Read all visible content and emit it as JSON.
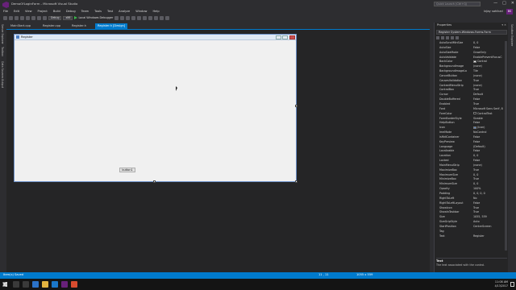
{
  "window": {
    "title": "DemoOfLoginForm - Microsoft Visual Studio",
    "quick_launch_placeholder": "Quick Launch (Ctrl+Q)",
    "user_name": "bijay sahikari",
    "user_initials": "BS",
    "controls": [
      "—",
      "□",
      "✕"
    ]
  },
  "menu": [
    "File",
    "Edit",
    "View",
    "Project",
    "Build",
    "Debug",
    "Team",
    "Tools",
    "Test",
    "Analyze",
    "Window",
    "Help"
  ],
  "toolbar": {
    "config": "Debug",
    "platform": "x86",
    "debugger": "Local Windows Debugger"
  },
  "left_tabs": [
    "Server Explorer",
    "Toolbox",
    "Data Sources",
    "Output"
  ],
  "right_tabs": [
    "Solution Explorer"
  ],
  "doc_tabs": [
    {
      "label": "MainStart.cpp",
      "active": false
    },
    {
      "label": "Register.cpp",
      "active": false
    },
    {
      "label": "Register.h",
      "active": false
    },
    {
      "label": "Register.h [Design]",
      "active": true
    }
  ],
  "form": {
    "title": "Register",
    "submit_label": "button1"
  },
  "properties": {
    "panel_title": "Properties",
    "pin": "▾ ✕",
    "object": "Register  System.Windows.Forms.Form",
    "rows": [
      {
        "name": "AutoScrollMinSize",
        "value": "0, 0"
      },
      {
        "name": "AutoSize",
        "value": "False"
      },
      {
        "name": "AutoSizeMode",
        "value": "GrowOnly"
      },
      {
        "name": "AutoValidate",
        "value": "EnablePreventFocusC"
      },
      {
        "name": "BackColor",
        "value": "Control",
        "swatch": "#f0f0f0"
      },
      {
        "name": "BackgroundImage",
        "value": "(none)"
      },
      {
        "name": "BackgroundImageLa",
        "value": "Tile"
      },
      {
        "name": "CancelButton",
        "value": "(none)"
      },
      {
        "name": "CausesValidation",
        "value": "True"
      },
      {
        "name": "ContextMenuStrip",
        "value": "(none)"
      },
      {
        "name": "ControlBox",
        "value": "True"
      },
      {
        "name": "Cursor",
        "value": "Default"
      },
      {
        "name": "DoubleBuffered",
        "value": "False"
      },
      {
        "name": "Enabled",
        "value": "True"
      },
      {
        "name": "Font",
        "value": "Microsoft Sans Serif, 8"
      },
      {
        "name": "ForeColor",
        "value": "ControlText",
        "swatch": "#000000"
      },
      {
        "name": "FormBorderStyle",
        "value": "Sizable"
      },
      {
        "name": "HelpButton",
        "value": "False"
      },
      {
        "name": "Icon",
        "value": "(Icon)",
        "swatch": "#4d7fc3"
      },
      {
        "name": "ImeMode",
        "value": "NoControl"
      },
      {
        "name": "IsMdiContainer",
        "value": "False"
      },
      {
        "name": "KeyPreview",
        "value": "False"
      },
      {
        "name": "Language",
        "value": "(Default)"
      },
      {
        "name": "Localizable",
        "value": "False"
      },
      {
        "name": "Location",
        "value": "0, 0"
      },
      {
        "name": "Locked",
        "value": "False"
      },
      {
        "name": "MainMenuStrip",
        "value": "(none)"
      },
      {
        "name": "MaximizeBox",
        "value": "True"
      },
      {
        "name": "MaximumSize",
        "value": "0, 0"
      },
      {
        "name": "MinimizeBox",
        "value": "True"
      },
      {
        "name": "MinimumSize",
        "value": "0, 0"
      },
      {
        "name": "Opacity",
        "value": "100%"
      },
      {
        "name": "Padding",
        "value": "0, 0, 0, 0"
      },
      {
        "name": "RightToLeft",
        "value": "No"
      },
      {
        "name": "RightToLeftLayout",
        "value": "False"
      },
      {
        "name": "ShowIcon",
        "value": "True"
      },
      {
        "name": "ShowInTaskbar",
        "value": "True"
      },
      {
        "name": "Size",
        "value": "1055, 559"
      },
      {
        "name": "SizeGripStyle",
        "value": "Auto"
      },
      {
        "name": "StartPosition",
        "value": "CenterScreen"
      },
      {
        "name": "Tag",
        "value": ""
      },
      {
        "name": "Text",
        "value": "Register"
      }
    ],
    "desc_title": "Text",
    "desc_text": "The text associated with the control."
  },
  "status": {
    "left": "Item(s) Saved",
    "position": "11 , 11",
    "size": "1055 x 559"
  },
  "taskbar": {
    "time": "11:08 AM",
    "date": "4/13/2017"
  },
  "colors": {
    "accent": "#007acc",
    "vs_purple": "#68217a"
  }
}
